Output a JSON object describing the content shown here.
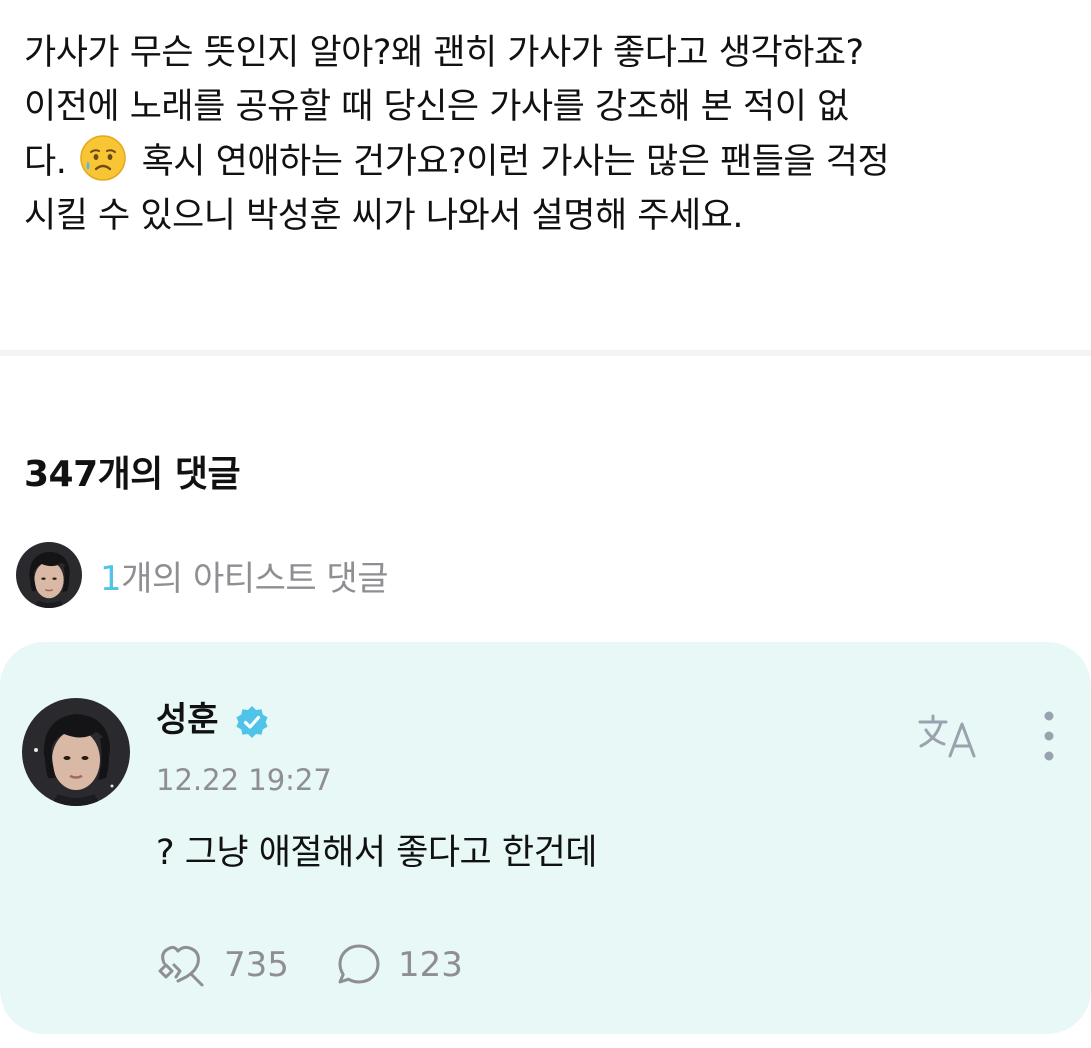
{
  "post": {
    "lines": [
      "가사가 무슨 뜻인지 알아?왜 괜히 가사가 좋다고 생각하죠?",
      "이전에 노래를 공유할 때 당신은 가사를 강조해 본 적이 없",
      "다.",
      "혹시 연애하는 건가요?이런 가사는 많은 팬들을 걱정",
      "시킬 수 있으니 박성훈 씨가 나와서 설명해 주세요."
    ],
    "emoji": "sad-but-relieved-face-icon"
  },
  "comments": {
    "count_label": "347개의 댓글",
    "artist_summary": {
      "count": "1",
      "label": "개의 아티스트 댓글"
    }
  },
  "artist_comment": {
    "author": "성훈",
    "verified": true,
    "timestamp": "12.22 19:27",
    "text": "? 그냥 애절해서 좋다고 한건데",
    "likes": "735",
    "replies": "123"
  },
  "colors": {
    "accent": "#4fc3e8",
    "card_background": "#e8f8f6",
    "muted_text": "#8e8e93"
  }
}
